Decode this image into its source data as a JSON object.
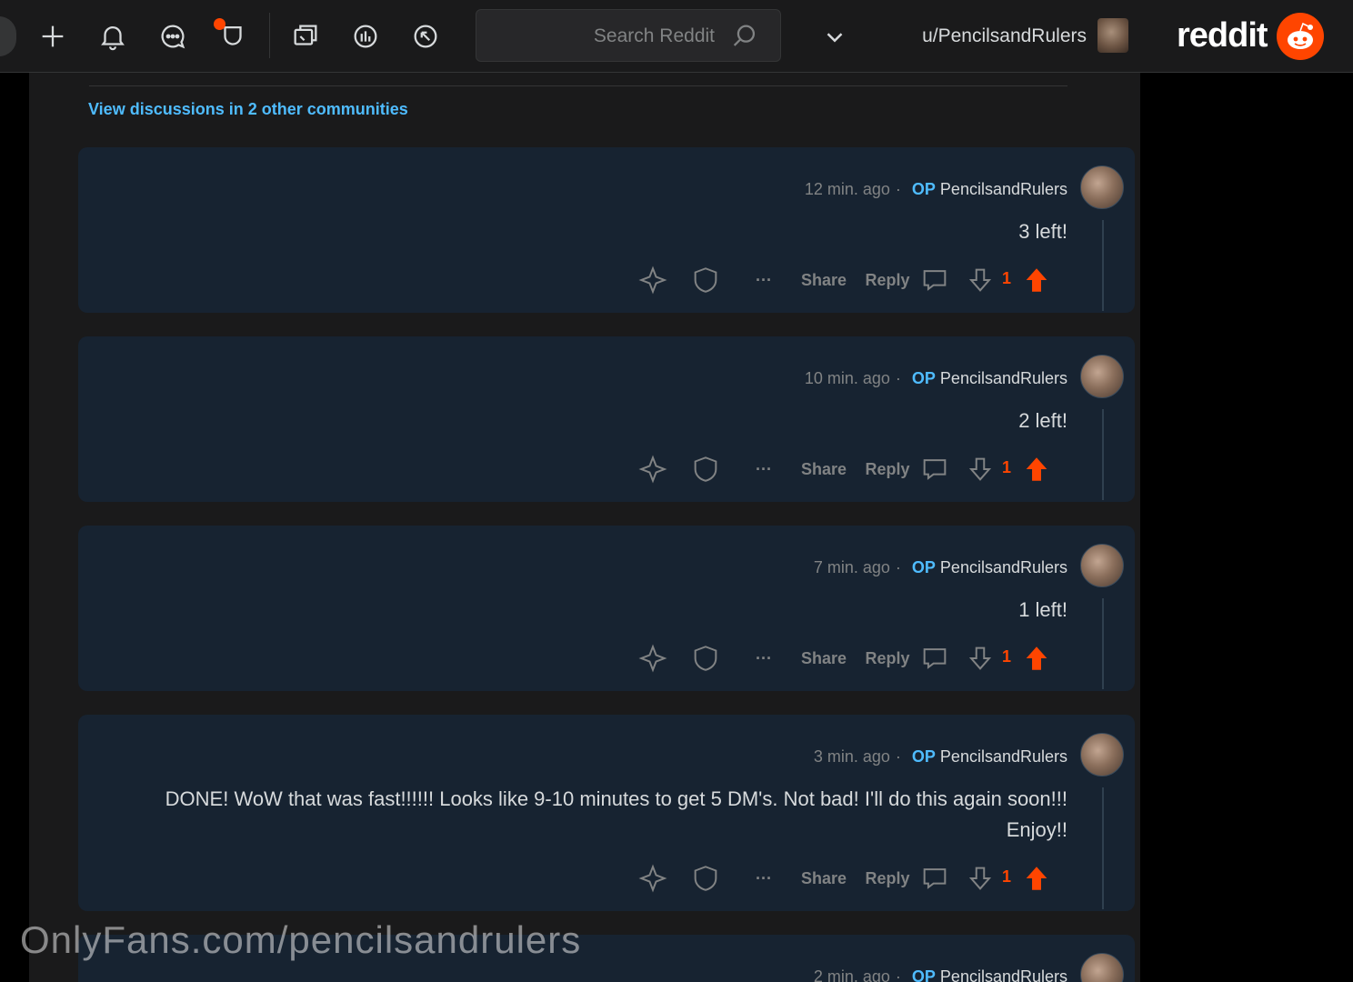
{
  "header": {
    "brand_word": "reddit",
    "username": "u/PencilsandRulers",
    "search_placeholder": "Search Reddit",
    "icons": [
      "chevron-down-icon",
      "popular-icon",
      "explore-icon",
      "coins-icon",
      "chat-icon",
      "notification-icon",
      "create-icon",
      "premium-icon"
    ]
  },
  "thread": {
    "view_discussions_link": "View discussions in 2 other communities",
    "comments": [
      {
        "author": "PencilsandRulers",
        "op_badge": "OP",
        "separator": "·",
        "time": "12 min. ago",
        "body": "3 left!",
        "score": "1",
        "reply_label": "Reply",
        "share_label": "Share",
        "more_label": "···"
      },
      {
        "author": "PencilsandRulers",
        "op_badge": "OP",
        "separator": "·",
        "time": "10 min. ago",
        "body": "2 left!",
        "score": "1",
        "reply_label": "Reply",
        "share_label": "Share",
        "more_label": "···"
      },
      {
        "author": "PencilsandRulers",
        "op_badge": "OP",
        "separator": "·",
        "time": "7 min. ago",
        "body": "1 left!",
        "score": "1",
        "reply_label": "Reply",
        "share_label": "Share",
        "more_label": "···"
      },
      {
        "author": "PencilsandRulers",
        "op_badge": "OP",
        "separator": "·",
        "time": "3 min. ago",
        "body": "DONE! WoW that was fast!!!!!! Looks like 9-10 minutes to get 5 DM's. Not bad! I'll do this again soon!!! Enjoy!!",
        "score": "1",
        "reply_label": "Reply",
        "share_label": "Share",
        "more_label": "···"
      },
      {
        "author": "PencilsandRulers",
        "op_badge": "OP",
        "separator": "·",
        "time": "2 min. ago"
      }
    ]
  },
  "watermark": "OnlyFans.com/pencilsandrulers",
  "colors": {
    "accent": "#ff4500",
    "link": "#4fbcff",
    "card": "#172331",
    "panel": "#1a1a1b"
  }
}
